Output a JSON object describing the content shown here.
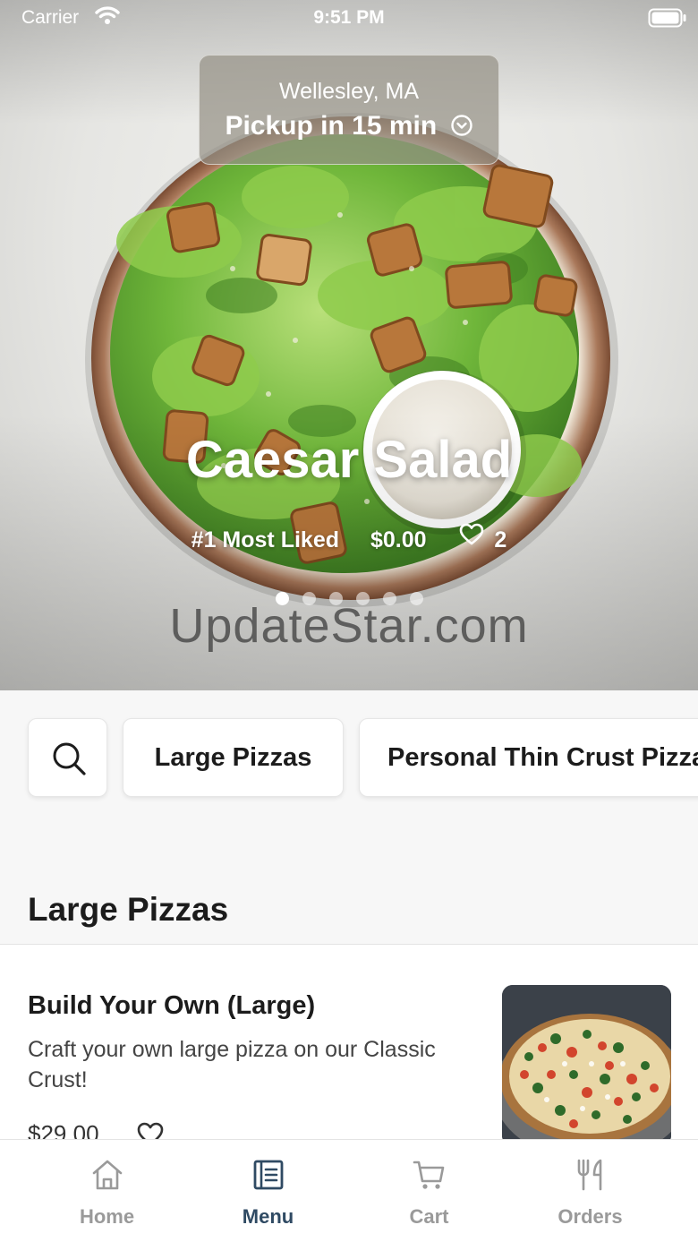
{
  "status_bar": {
    "carrier": "Carrier",
    "time": "9:51 PM"
  },
  "location": {
    "city": "Wellesley, MA",
    "pickup": "Pickup in 15 min"
  },
  "promo": {
    "title": "Caesar Salad",
    "badge": "#1 Most Liked",
    "price": "$0.00",
    "likes": "2",
    "slide_count": 6,
    "active_slide": 1
  },
  "watermark": "UpdateStar.com",
  "categories": {
    "search_icon": "search-icon",
    "items": [
      "Large Pizzas",
      "Personal Thin Crust Pizza"
    ]
  },
  "section": {
    "title": "Large Pizzas"
  },
  "menu_items": [
    {
      "name": "Build Your Own (Large)",
      "description": "Craft your own large pizza on our Classic Crust!",
      "price": "$29.00"
    }
  ],
  "tabs": [
    {
      "label": "Home",
      "icon": "home-icon",
      "active": false
    },
    {
      "label": "Menu",
      "icon": "menu-book-icon",
      "active": true
    },
    {
      "label": "Cart",
      "icon": "cart-icon",
      "active": false
    },
    {
      "label": "Orders",
      "icon": "fork-knife-icon",
      "active": false
    }
  ],
  "colors": {
    "accent": "#2f4a63",
    "inactive_tab": "#9a9a9a",
    "background": "#f7f7f7"
  }
}
